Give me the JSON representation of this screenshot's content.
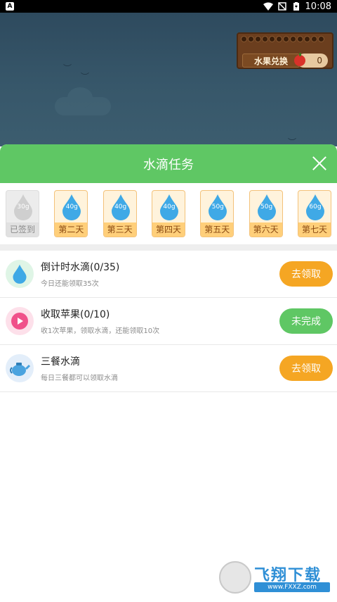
{
  "status_bar": {
    "app_badge": "A",
    "time": "10:08"
  },
  "game": {
    "fruit_exchange_label": "水果兑换",
    "fruit_count": "0"
  },
  "sheet": {
    "title": "水滴任务",
    "days": [
      {
        "amount": "30g",
        "label": "已签到",
        "state": "done"
      },
      {
        "amount": "40g",
        "label": "第二天",
        "state": "pending"
      },
      {
        "amount": "40g",
        "label": "第三天",
        "state": "pending"
      },
      {
        "amount": "40g",
        "label": "第四天",
        "state": "pending"
      },
      {
        "amount": "50g",
        "label": "第五天",
        "state": "pending"
      },
      {
        "amount": "50g",
        "label": "第六天",
        "state": "pending"
      },
      {
        "amount": "60g",
        "label": "第七天",
        "state": "pending"
      }
    ],
    "tasks": [
      {
        "title": "倒计时水滴(0/35)",
        "desc": "今日还能领取35次",
        "button": "去领取",
        "icon": "water-drop-icon",
        "button_color": "#f5a623",
        "icon_bg": "#dff5e6"
      },
      {
        "title": "收取苹果(0/10)",
        "desc": "收1次苹果，领取水滴，还能领取10次",
        "button": "未完成",
        "icon": "play-icon",
        "button_color": "#5fc764",
        "icon_bg": "#fde0ea"
      },
      {
        "title": "三餐水滴",
        "desc": "每日三餐都可以领取水滴",
        "button": "去领取",
        "icon": "teapot-icon",
        "button_color": "#f5a623",
        "icon_bg": "#e3eefa"
      }
    ]
  },
  "watermark": {
    "title": "飞翔下载",
    "url": "www.FXXZ.com"
  },
  "colors": {
    "header_green": "#5fc764",
    "orange": "#f5a623",
    "drop_blue": "#3fa9e6"
  }
}
